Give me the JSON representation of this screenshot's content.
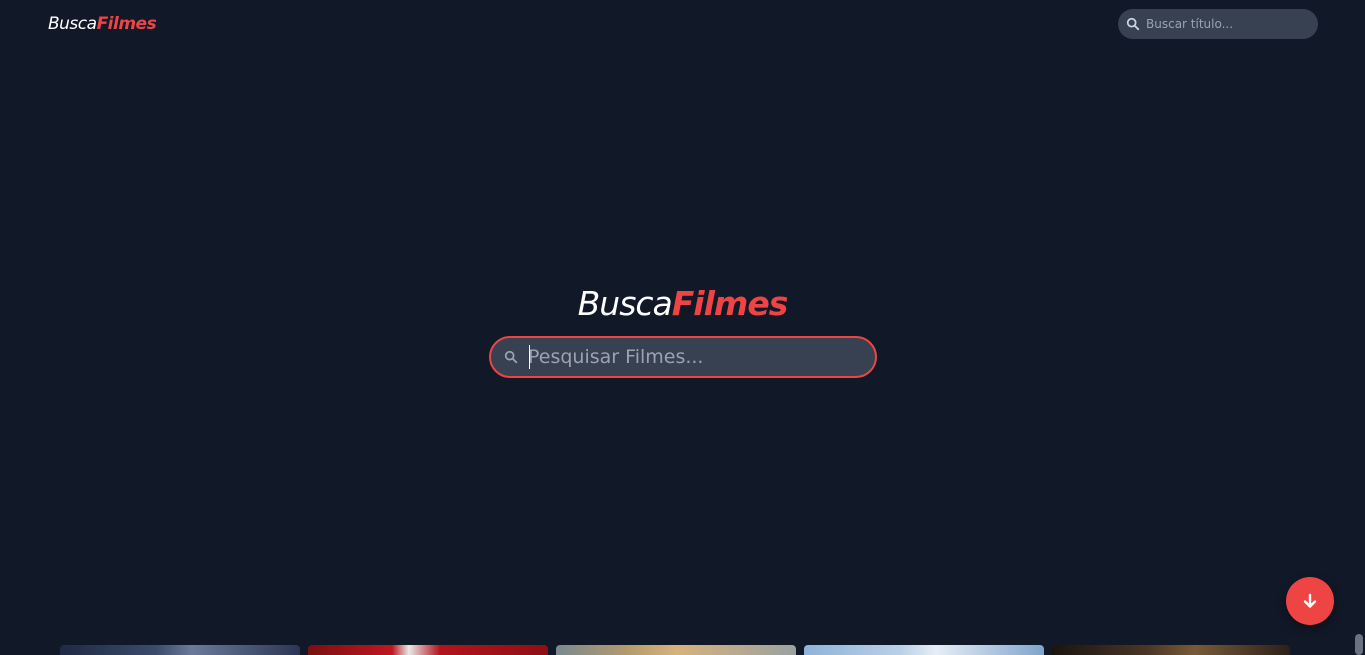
{
  "header": {
    "logo_part1": "Busca",
    "logo_part2": "Filmes",
    "search_placeholder": "Buscar título..."
  },
  "hero": {
    "title_part1": "Busca",
    "title_part2": "Filmes",
    "search_placeholder": "Pesquisar Filmes..."
  },
  "icons": {
    "search": "search-icon",
    "scroll_down": "arrow-down-icon"
  },
  "colors": {
    "background": "#111827",
    "accent": "#ef4444",
    "input_bg": "#374151",
    "placeholder": "#9ca3af"
  },
  "posters": [
    "poster-1",
    "poster-2",
    "poster-3",
    "poster-4",
    "poster-5"
  ]
}
